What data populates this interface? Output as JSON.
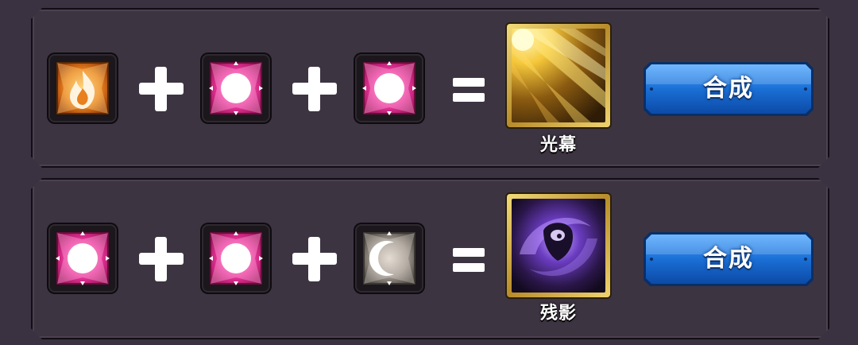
{
  "recipes": [
    {
      "ingredients": [
        {
          "icon": "fire-gem-icon",
          "color": "#e8801f"
        },
        {
          "icon": "light-gem-icon",
          "color": "#e53b8c"
        },
        {
          "icon": "light-gem-icon",
          "color": "#e53b8c"
        }
      ],
      "result": {
        "icon": "golden-light-rays-icon",
        "name": "光幕"
      },
      "button_label": "合成"
    },
    {
      "ingredients": [
        {
          "icon": "light-gem-icon",
          "color": "#e53b8c"
        },
        {
          "icon": "light-gem-icon",
          "color": "#e53b8c"
        },
        {
          "icon": "moon-gem-icon",
          "color": "#9c948c"
        }
      ],
      "result": {
        "icon": "purple-shadow-vortex-icon",
        "name": "残影"
      },
      "button_label": "合成"
    }
  ],
  "colors": {
    "background": "#3b3241",
    "button_blue": "#1a6fd6",
    "result_frame_gold": "#e8c764"
  }
}
